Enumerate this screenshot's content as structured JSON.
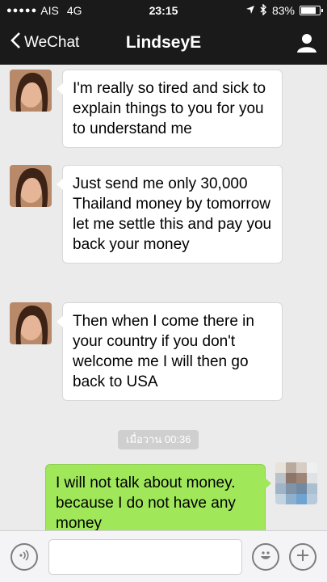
{
  "status_bar": {
    "carrier": "AIS",
    "network": "4G",
    "time": "23:15",
    "battery": "83%",
    "battery_level": 0.83
  },
  "nav": {
    "back_label": "WeChat",
    "title": "LindseyE"
  },
  "messages": [
    {
      "from": "contact",
      "text": "I'm really so tired and sick to explain things to you for you to understand me"
    },
    {
      "from": "contact",
      "text": "Just send me only 30,000 Thailand money by tomorrow let me settle this and pay you back your money"
    },
    {
      "from": "contact",
      "text": "Then when I come there in your country if you don't welcome me I will then go back to USA"
    },
    {
      "from": "me",
      "text": "I will not talk about money. because I do not have any money"
    }
  ],
  "timestamp": "เมื่อวาน 00:36",
  "colors": {
    "header_bg": "#1a1a1a",
    "chat_bg": "#ebebeb",
    "outgoing_bubble": "#a0e75a",
    "incoming_bubble": "#ffffff"
  },
  "icons": {
    "back": "chevron-left-icon",
    "profile": "person-icon",
    "voice": "voice-icon",
    "emoji": "smiley-icon",
    "more": "plus-icon"
  }
}
